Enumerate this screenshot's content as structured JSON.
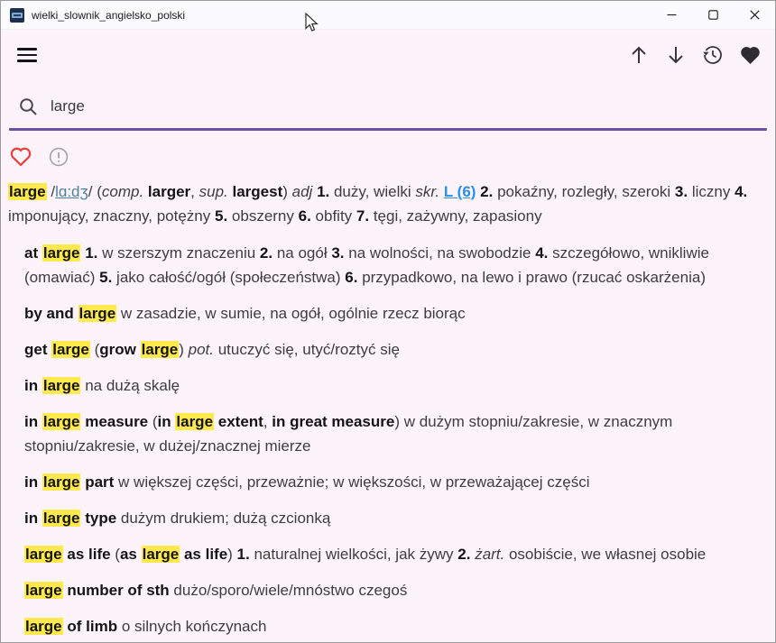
{
  "window": {
    "title": "wielki_slownik_angielsko_polski",
    "controls": [
      {
        "name": "minimize"
      },
      {
        "name": "maximize"
      },
      {
        "name": "close"
      }
    ]
  },
  "colors": {
    "accent_purple": "#6950a3",
    "highlight_yellow": "#ffe94d",
    "heart_red": "#e8413c",
    "link_blue": "#2b8fea",
    "pronunciation_link_blue": "#4d7f9f",
    "app_background": "#fdf4fb",
    "icon_dark": "#3a3540"
  },
  "icons": [
    "menu-icon",
    "arrow-up-icon",
    "arrow-down-icon",
    "history-icon",
    "favorite-filled-icon",
    "search-icon",
    "favorite-outline-icon",
    "info-icon"
  ],
  "search": {
    "value": "large",
    "placeholder": ""
  },
  "entry": {
    "headword": "large",
    "pronunciation": "lɑ:dʒ",
    "segments": [
      {
        "t": "large",
        "s": "h"
      },
      {
        "t": " /",
        "s": "n"
      },
      {
        "t": "lɑ:dʒ",
        "s": "p"
      },
      {
        "t": "/ (",
        "s": "n"
      },
      {
        "t": "comp.",
        "s": "i"
      },
      {
        "t": " ",
        "s": "n"
      },
      {
        "t": "larger",
        "s": "b"
      },
      {
        "t": ", ",
        "s": "n"
      },
      {
        "t": "sup.",
        "s": "i"
      },
      {
        "t": " ",
        "s": "n"
      },
      {
        "t": "largest",
        "s": "b"
      },
      {
        "t": ") ",
        "s": "n"
      },
      {
        "t": "adj",
        "s": "i"
      },
      {
        "t": " ",
        "s": "n"
      },
      {
        "t": "1.",
        "s": "b"
      },
      {
        "t": " duży, wielki ",
        "s": "n"
      },
      {
        "t": "skr.",
        "s": "i"
      },
      {
        "t": " ",
        "s": "n"
      },
      {
        "t": "L (6)",
        "s": "l"
      },
      {
        "t": " ",
        "s": "n"
      },
      {
        "t": "2.",
        "s": "b"
      },
      {
        "t": " pokaźny, rozległy, szeroki ",
        "s": "n"
      },
      {
        "t": "3.",
        "s": "b"
      },
      {
        "t": " liczny ",
        "s": "n"
      },
      {
        "t": "4.",
        "s": "b"
      },
      {
        "t": " imponujący, znaczny, potężny ",
        "s": "n"
      },
      {
        "t": "5.",
        "s": "b"
      },
      {
        "t": " obszerny ",
        "s": "n"
      },
      {
        "t": "6.",
        "s": "b"
      },
      {
        "t": " obfity ",
        "s": "n"
      },
      {
        "t": "7.",
        "s": "b"
      },
      {
        "t": " tęgi, zażywny, zapasiony",
        "s": "n"
      }
    ]
  },
  "phrases": [
    {
      "segments": [
        {
          "t": "at ",
          "s": "b"
        },
        {
          "t": "large",
          "s": "h"
        },
        {
          "t": " ",
          "s": "n"
        },
        {
          "t": "1.",
          "s": "b"
        },
        {
          "t": " w szerszym znaczeniu ",
          "s": "n"
        },
        {
          "t": "2.",
          "s": "b"
        },
        {
          "t": " na ogół ",
          "s": "n"
        },
        {
          "t": "3.",
          "s": "b"
        },
        {
          "t": " na wolności, na swobodzie ",
          "s": "n"
        },
        {
          "t": "4.",
          "s": "b"
        },
        {
          "t": " szczegółowo, wnikliwie (omawiać) ",
          "s": "n"
        },
        {
          "t": "5.",
          "s": "b"
        },
        {
          "t": " jako całość/ogół (społeczeństwa) ",
          "s": "n"
        },
        {
          "t": "6.",
          "s": "b"
        },
        {
          "t": " przypadkowo, na lewo i prawo (rzucać oskarżenia)",
          "s": "n"
        }
      ]
    },
    {
      "segments": [
        {
          "t": "by and ",
          "s": "b"
        },
        {
          "t": "large",
          "s": "h"
        },
        {
          "t": " w zasadzie, w sumie, na ogół, ogólnie rzecz biorąc",
          "s": "n"
        }
      ]
    },
    {
      "segments": [
        {
          "t": "get ",
          "s": "b"
        },
        {
          "t": "large",
          "s": "h"
        },
        {
          "t": " (",
          "s": "n"
        },
        {
          "t": "grow ",
          "s": "b"
        },
        {
          "t": "large",
          "s": "h"
        },
        {
          "t": ") ",
          "s": "n"
        },
        {
          "t": "pot.",
          "s": "i"
        },
        {
          "t": " utuczyć się, utyć/roztyć się",
          "s": "n"
        }
      ]
    },
    {
      "segments": [
        {
          "t": "in ",
          "s": "b"
        },
        {
          "t": "large",
          "s": "h"
        },
        {
          "t": " na dużą skalę",
          "s": "n"
        }
      ]
    },
    {
      "segments": [
        {
          "t": "in ",
          "s": "b"
        },
        {
          "t": "large",
          "s": "h"
        },
        {
          "t": " measure",
          "s": "b"
        },
        {
          "t": " (",
          "s": "n"
        },
        {
          "t": "in ",
          "s": "b"
        },
        {
          "t": "large",
          "s": "h"
        },
        {
          "t": " extent",
          "s": "b"
        },
        {
          "t": ", ",
          "s": "n"
        },
        {
          "t": "in great measure",
          "s": "b"
        },
        {
          "t": ") w dużym stopniu/zakresie, w znacznym stopniu/zakresie, w dużej/znacznej mierze",
          "s": "n"
        }
      ]
    },
    {
      "segments": [
        {
          "t": "in ",
          "s": "b"
        },
        {
          "t": "large",
          "s": "h"
        },
        {
          "t": " part",
          "s": "b"
        },
        {
          "t": " w większej części, przeważnie; w większości, w przeważającej części",
          "s": "n"
        }
      ]
    },
    {
      "segments": [
        {
          "t": "in ",
          "s": "b"
        },
        {
          "t": "large",
          "s": "h"
        },
        {
          "t": " type",
          "s": "b"
        },
        {
          "t": " dużym drukiem; dużą czcionką",
          "s": "n"
        }
      ]
    },
    {
      "segments": [
        {
          "t": "large",
          "s": "h"
        },
        {
          "t": " as life",
          "s": "b"
        },
        {
          "t": " (",
          "s": "n"
        },
        {
          "t": "as ",
          "s": "b"
        },
        {
          "t": "large",
          "s": "h"
        },
        {
          "t": " as life",
          "s": "b"
        },
        {
          "t": ") ",
          "s": "n"
        },
        {
          "t": "1.",
          "s": "b"
        },
        {
          "t": " naturalnej wielkości, jak żywy ",
          "s": "n"
        },
        {
          "t": "2.",
          "s": "b"
        },
        {
          "t": " ",
          "s": "n"
        },
        {
          "t": "żart.",
          "s": "i"
        },
        {
          "t": " osobiście, we własnej osobie",
          "s": "n"
        }
      ]
    },
    {
      "segments": [
        {
          "t": "large",
          "s": "h"
        },
        {
          "t": " number of sth",
          "s": "b"
        },
        {
          "t": " dużo/sporo/wiele/mnóstwo czegoś",
          "s": "n"
        }
      ]
    },
    {
      "segments": [
        {
          "t": "large",
          "s": "h"
        },
        {
          "t": " of limb",
          "s": "b"
        },
        {
          "t": " o silnych kończynach",
          "s": "n"
        }
      ]
    }
  ]
}
